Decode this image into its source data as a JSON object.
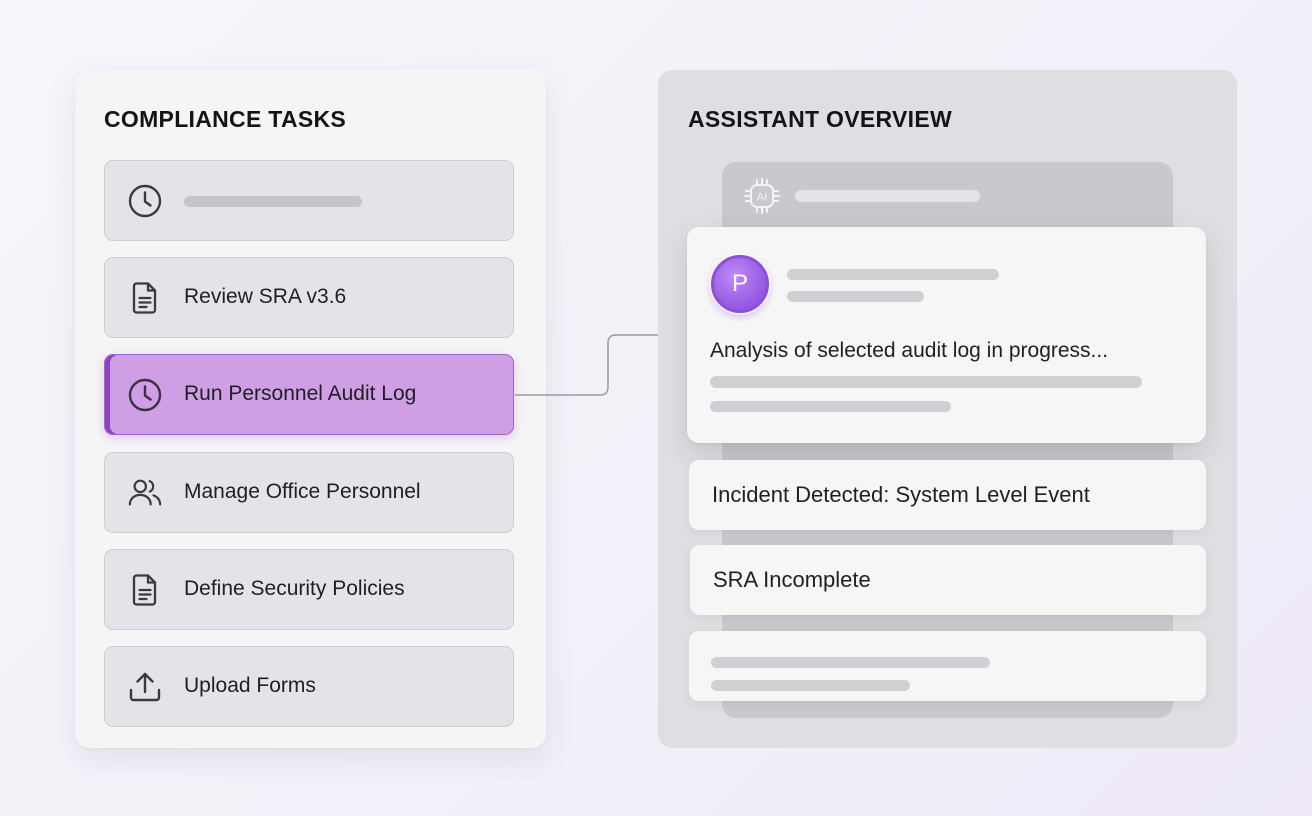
{
  "compliance": {
    "title": "COMPLIANCE TASKS",
    "tasks": [
      {
        "label": "",
        "icon": "clock-icon",
        "placeholder": true
      },
      {
        "label": "Review SRA v3.6",
        "icon": "document-icon"
      },
      {
        "label": "Run Personnel Audit Log",
        "icon": "clock-icon",
        "active": true
      },
      {
        "label": "Manage Office Personnel",
        "icon": "users-icon"
      },
      {
        "label": "Define Security Policies",
        "icon": "document-icon"
      },
      {
        "label": "Upload Forms",
        "icon": "upload-icon"
      }
    ]
  },
  "assistant": {
    "title": "ASSISTANT OVERVIEW",
    "ai_icon": "ai-chip-icon",
    "avatar_initial": "P",
    "status_text": "Analysis of selected audit log in progress...",
    "cards": [
      {
        "label": "Incident Detected: System Level Event"
      },
      {
        "label": "SRA Incomplete"
      }
    ]
  },
  "colors": {
    "accent": "#cf9ee4",
    "accent_border": "#a463cf",
    "avatar": "#9a5fe6",
    "connector": "#9a9aa2"
  }
}
